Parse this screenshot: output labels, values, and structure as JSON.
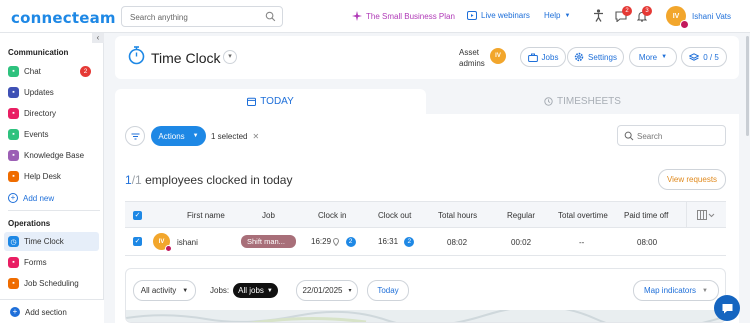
{
  "topbar": {
    "logo": "connecteam",
    "search_placeholder": "Search anything",
    "promo_label": "The Small Business Plan",
    "webinars_label": "Live webinars",
    "help_label": "Help",
    "chat_badge": "2",
    "notif_badge": "3",
    "user_initials": "IV",
    "user_name": "Ishani Vats"
  },
  "sidebar": {
    "section_communication": "Communication",
    "communication_items": [
      {
        "label": "Chat",
        "icon": "chat-icon",
        "color": "#2ec27e",
        "count": "2"
      },
      {
        "label": "Updates",
        "icon": "updates-icon",
        "color": "#3f51b5"
      },
      {
        "label": "Directory",
        "icon": "directory-icon",
        "color": "#e91e63"
      },
      {
        "label": "Events",
        "icon": "events-icon",
        "color": "#2ec27e"
      },
      {
        "label": "Knowledge Base",
        "icon": "knowledge-base-icon",
        "color": "#9c5fb5"
      },
      {
        "label": "Help Desk",
        "icon": "help-desk-icon",
        "color": "#ef6c00"
      }
    ],
    "add_new": "Add new",
    "section_operations": "Operations",
    "operations_items": [
      {
        "label": "Time Clock",
        "icon": "time-clock-icon",
        "color": "#1e88e5",
        "active": true
      },
      {
        "label": "Forms",
        "icon": "forms-icon",
        "color": "#e91e63"
      },
      {
        "label": "Job Scheduling",
        "icon": "job-scheduling-icon",
        "color": "#ef6c00"
      }
    ],
    "add_section": "Add section"
  },
  "header": {
    "title": "Time Clock",
    "asset_admins_line1": "Asset",
    "asset_admins_line2": "admins",
    "asset_admin_initials": "IV",
    "jobs_label": "Jobs",
    "settings_label": "Settings",
    "more_label": "More",
    "counter_label": "0 / 5"
  },
  "tabs": {
    "today": "TODAY",
    "timesheets": "TIMESHEETS"
  },
  "toolbar": {
    "actions_label": "Actions",
    "selected_text": "1 selected",
    "search_placeholder": "Search"
  },
  "summary": {
    "clocked_count": "1",
    "clocked_sep": "/",
    "clocked_total": "1",
    "clocked_text": "employees clocked in today",
    "view_requests": "View requests"
  },
  "table": {
    "columns": [
      "First name",
      "Job",
      "Clock in",
      "Clock out",
      "Total hours",
      "Regular",
      "Total overtime",
      "Paid time off"
    ],
    "rows": [
      {
        "initials": "IV",
        "first_name": "ishani",
        "job": "Shift man...",
        "clock_in": "16:29",
        "clock_in_badge": "2",
        "clock_out": "16:31",
        "clock_out_badge": "2",
        "total_hours": "08:02",
        "regular": "00:02",
        "total_overtime": "--",
        "paid_time_off": "08:00"
      }
    ]
  },
  "activity": {
    "filter_label": "All activity",
    "jobs_label": "Jobs:",
    "jobs_value": "All jobs",
    "date_value": "22/01/2025",
    "today_label": "Today",
    "map_indicators": "Map indicators"
  }
}
